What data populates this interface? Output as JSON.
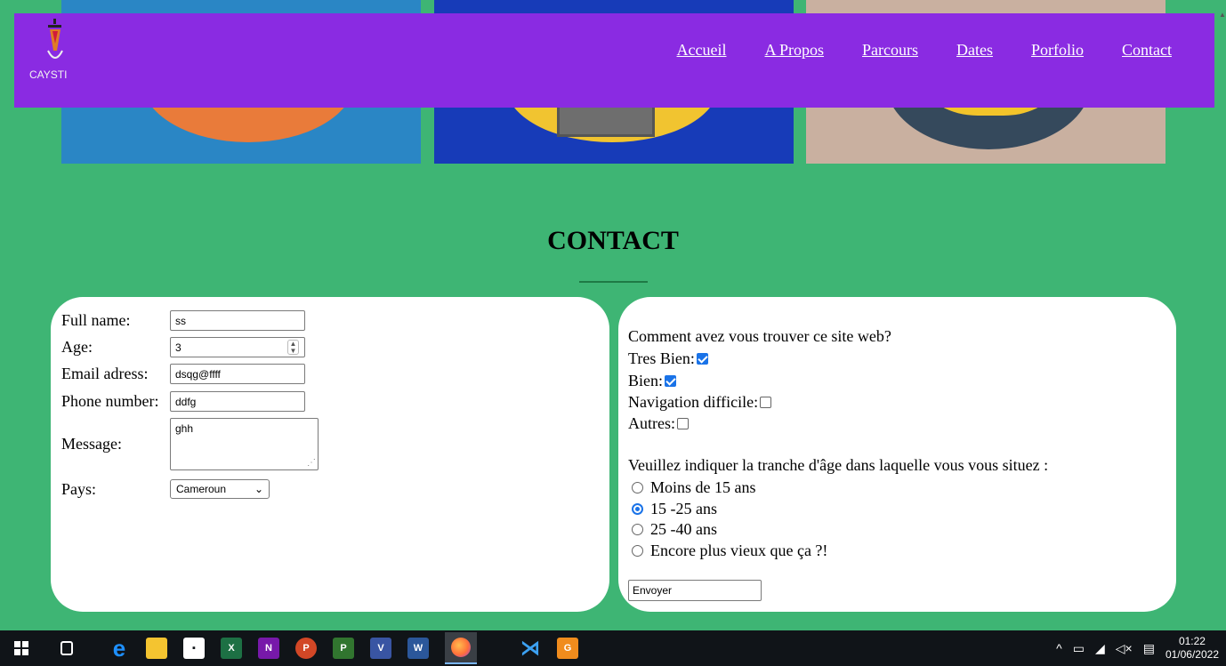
{
  "header": {
    "logo_text": "CAYSTI",
    "nav": [
      "Accueil",
      "A Propos",
      "Parcours",
      "Dates",
      "Porfolio",
      "Contact"
    ]
  },
  "section_title": "CONTACT",
  "form": {
    "full_name": {
      "label": "Full name:",
      "value": "ss"
    },
    "age": {
      "label": "Age:",
      "value": "3"
    },
    "email": {
      "label": "Email adress:",
      "value": "dsqg@ffff"
    },
    "phone": {
      "label": "Phone number:",
      "value": "ddfg"
    },
    "message": {
      "label": "Message:",
      "value": "ghh"
    },
    "country": {
      "label": "Pays:",
      "value": "Cameroun"
    }
  },
  "survey": {
    "question": "Comment avez vous trouver ce site web?",
    "checkboxes": [
      {
        "label": "Tres Bien:",
        "checked": true
      },
      {
        "label": "Bien:",
        "checked": true
      },
      {
        "label": "Navigation difficile:",
        "checked": false
      },
      {
        "label": "Autres:",
        "checked": false
      }
    ],
    "age_question": "Veuillez indiquer la tranche d'âge dans laquelle vous vous situez :",
    "radios": [
      {
        "label": "Moins de 15 ans",
        "checked": false
      },
      {
        "label": "15 -25 ans",
        "checked": true
      },
      {
        "label": "25 -40 ans",
        "checked": false
      },
      {
        "label": "Encore plus vieux que ça ?!",
        "checked": false
      }
    ],
    "submit": "Envoyer"
  },
  "taskbar": {
    "apps": [
      "windows-start",
      "task-view",
      "edge",
      "file-explorer",
      "store",
      "excel",
      "onenote",
      "powerpoint",
      "project",
      "visio",
      "word",
      "firefox",
      "vscode",
      "gimp"
    ],
    "time": "01:22",
    "date": "01/06/2022"
  }
}
